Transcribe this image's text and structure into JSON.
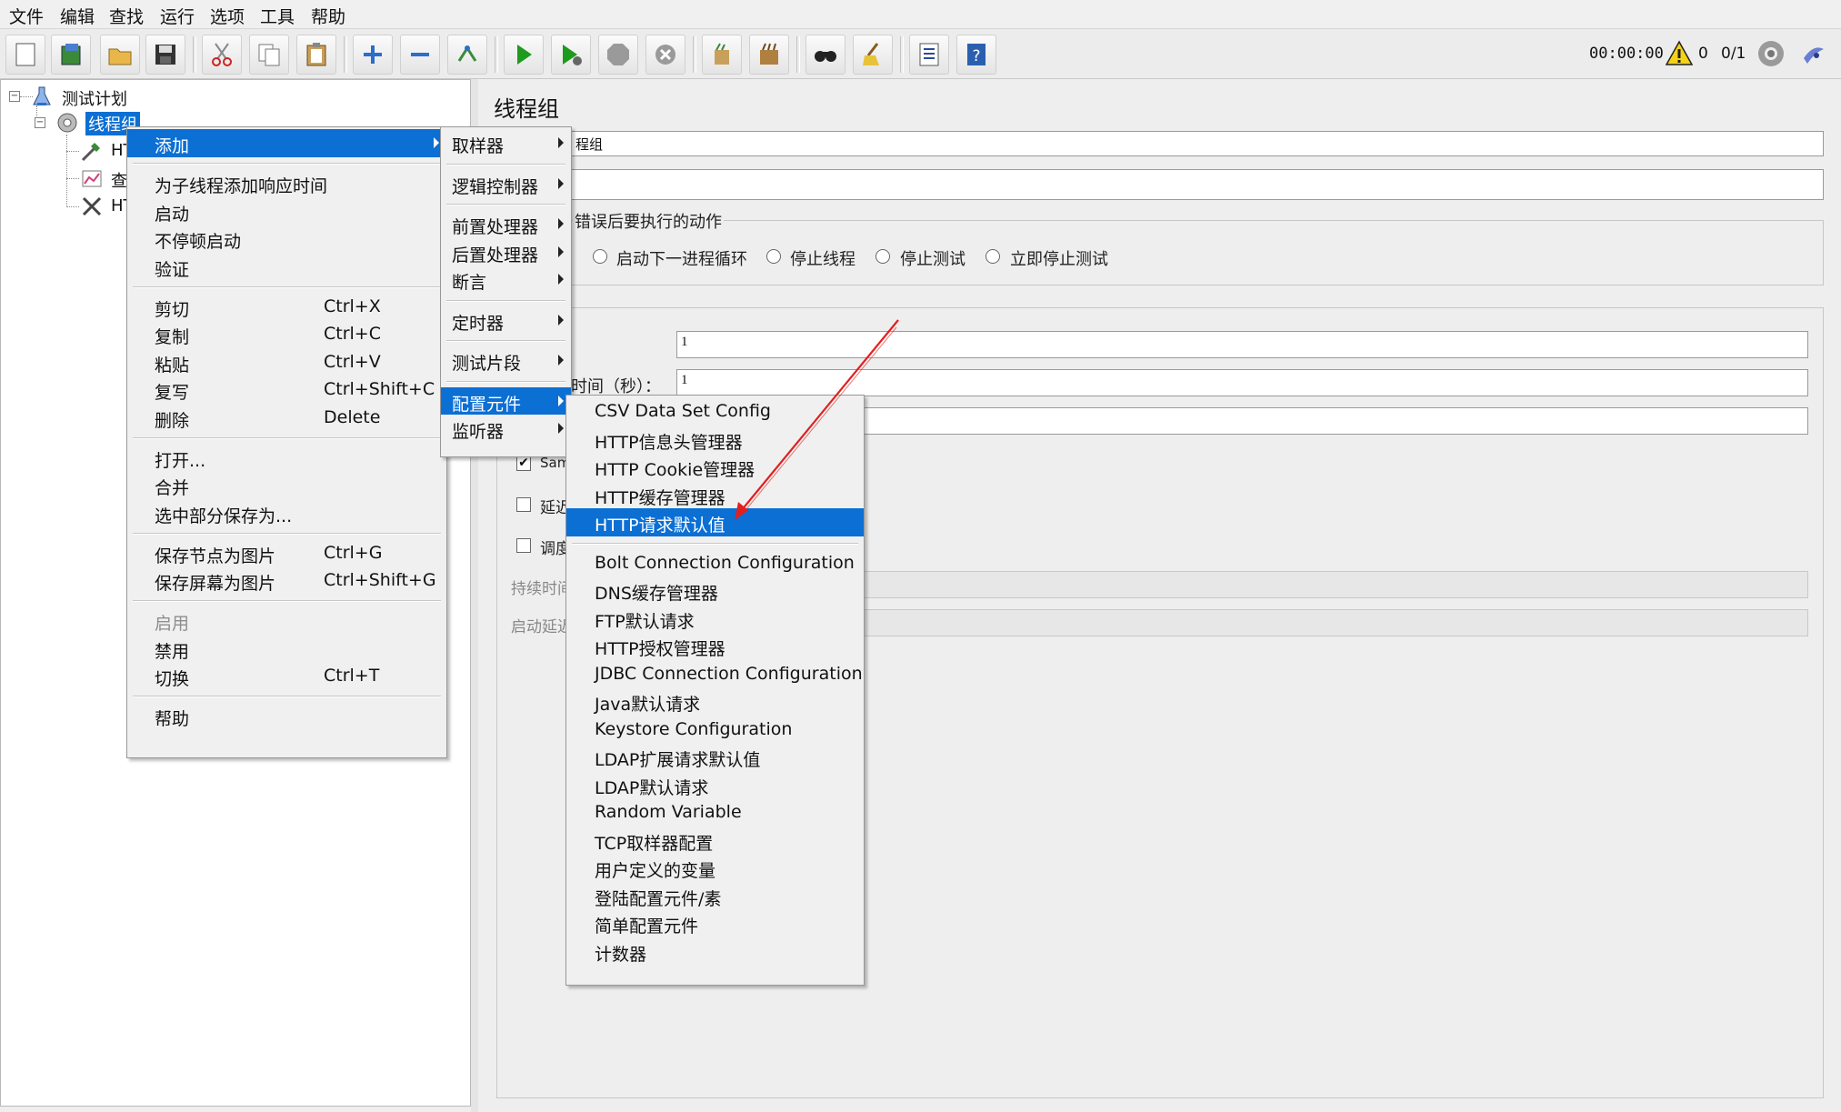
{
  "menubar": [
    "文件",
    "编辑",
    "查找",
    "运行",
    "选项",
    "工具",
    "帮助"
  ],
  "toolbar": {
    "icons": [
      "new-icon",
      "templates-icon",
      "open-icon",
      "save-icon",
      "cut-icon",
      "copy-icon",
      "paste-icon",
      "expand-icon",
      "collapse-icon",
      "toggle-icon",
      "start-icon",
      "start-no-pause-icon",
      "stop-icon",
      "shutdown-icon",
      "clear-icon",
      "clear-all-icon",
      "search-icon",
      "reset-search-icon",
      "function-helper-icon",
      "help-icon"
    ],
    "timer": "00:00:00",
    "warning_count": "0",
    "threads": "0/1"
  },
  "tree": {
    "root": "测试计划",
    "thread_group": "线程组",
    "children": [
      "HT",
      "查",
      "HT"
    ]
  },
  "panel": {
    "title": "线程组",
    "name_value": "程组",
    "on_error_legend": "错误后要执行的动作",
    "radios": [
      "启动下一进程循环",
      "停止线程",
      "停止测试",
      "立即停止测试"
    ],
    "threads_value": "1",
    "rampup_label": "时间（秒）：",
    "rampup_value": "1",
    "same_user_label": "Sam",
    "delay_label": "延迟",
    "scheduler_label": "调度",
    "duration_label": "持续时间",
    "startup_delay_label": "启动延迟"
  },
  "context_menu": {
    "items": [
      {
        "label": "添加",
        "submenu": true,
        "selected": true
      },
      {
        "sep": true
      },
      {
        "label": "为子线程添加响应时间"
      },
      {
        "label": "启动"
      },
      {
        "label": "不停顿启动"
      },
      {
        "label": "验证"
      },
      {
        "sep": true
      },
      {
        "label": "剪切",
        "shortcut": "Ctrl+X"
      },
      {
        "label": "复制",
        "shortcut": "Ctrl+C"
      },
      {
        "label": "粘贴",
        "shortcut": "Ctrl+V"
      },
      {
        "label": "复写",
        "shortcut": "Ctrl+Shift+C"
      },
      {
        "label": "删除",
        "shortcut": "Delete"
      },
      {
        "sep": true
      },
      {
        "label": "打开..."
      },
      {
        "label": "合并"
      },
      {
        "label": "选中部分保存为..."
      },
      {
        "sep": true
      },
      {
        "label": "保存节点为图片",
        "shortcut": "Ctrl+G"
      },
      {
        "label": "保存屏幕为图片",
        "shortcut": "Ctrl+Shift+G"
      },
      {
        "sep": true
      },
      {
        "label": "启用",
        "disabled": true
      },
      {
        "label": "禁用"
      },
      {
        "label": "切换",
        "shortcut": "Ctrl+T"
      },
      {
        "sep": true
      },
      {
        "label": "帮助"
      }
    ]
  },
  "add_submenu": {
    "items": [
      {
        "label": "取样器",
        "submenu": true
      },
      {
        "sep": true
      },
      {
        "label": "逻辑控制器",
        "submenu": true
      },
      {
        "sep": true
      },
      {
        "label": "前置处理器",
        "submenu": true
      },
      {
        "label": "后置处理器",
        "submenu": true
      },
      {
        "label": "断言",
        "submenu": true
      },
      {
        "sep": true
      },
      {
        "label": "定时器",
        "submenu": true
      },
      {
        "sep": true
      },
      {
        "label": "测试片段",
        "submenu": true
      },
      {
        "sep": true
      },
      {
        "label": "配置元件",
        "submenu": true,
        "selected": true
      },
      {
        "label": "监听器",
        "submenu": true
      }
    ]
  },
  "config_submenu": {
    "items": [
      {
        "label": "CSV Data Set Config"
      },
      {
        "label": "HTTP信息头管理器"
      },
      {
        "label": "HTTP Cookie管理器"
      },
      {
        "label": "HTTP缓存管理器"
      },
      {
        "label": "HTTP请求默认值",
        "selected": true
      },
      {
        "sep": true
      },
      {
        "label": "Bolt Connection Configuration"
      },
      {
        "label": "DNS缓存管理器"
      },
      {
        "label": "FTP默认请求"
      },
      {
        "label": "HTTP授权管理器"
      },
      {
        "label": "JDBC Connection Configuration"
      },
      {
        "label": "Java默认请求"
      },
      {
        "label": "Keystore Configuration"
      },
      {
        "label": "LDAP扩展请求默认值"
      },
      {
        "label": "LDAP默认请求"
      },
      {
        "label": "Random Variable"
      },
      {
        "label": "TCP取样器配置"
      },
      {
        "label": "用户定义的变量"
      },
      {
        "label": "登陆配置元件/素"
      },
      {
        "label": "简单配置元件"
      },
      {
        "label": "计数器"
      }
    ]
  },
  "colors": {
    "selection": "#0b6fd4",
    "annotation_arrow": "#e02020"
  }
}
